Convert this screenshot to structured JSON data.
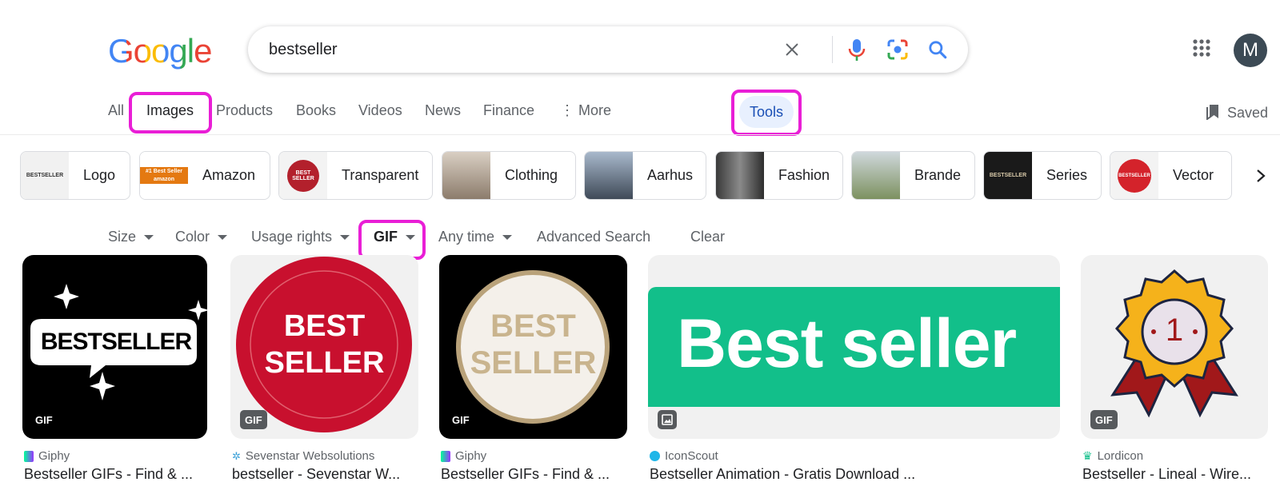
{
  "logo": {
    "text": "Google"
  },
  "search": {
    "value": "bestseller"
  },
  "icons": {
    "clear": "close-icon",
    "voice": "microphone-icon",
    "lens": "camera-lens-icon",
    "search": "search-icon",
    "apps": "apps-grid-icon",
    "saved": "bookmark-icon",
    "next": "chevron-right-icon"
  },
  "account": {
    "avatar_letter": "M",
    "color": "#3c4a55"
  },
  "tabs": [
    {
      "label": "All"
    },
    {
      "label": "Images"
    },
    {
      "label": "Products"
    },
    {
      "label": "Books"
    },
    {
      "label": "Videos"
    },
    {
      "label": "News"
    },
    {
      "label": "Finance"
    },
    {
      "label": "⋮ More"
    }
  ],
  "tools": {
    "label": "Tools"
  },
  "saved": {
    "label": "Saved"
  },
  "chips": [
    {
      "label": "Logo",
      "thumb_text": "BESTSELLER"
    },
    {
      "label": "Amazon",
      "thumb_text": "#1 Best Seller amazon"
    },
    {
      "label": "Transparent",
      "thumb_text": "BEST SELLER"
    },
    {
      "label": "Clothing"
    },
    {
      "label": "Aarhus"
    },
    {
      "label": "Fashion"
    },
    {
      "label": "Brande"
    },
    {
      "label": "Series",
      "thumb_text": "BESTSELLER"
    },
    {
      "label": "Vector",
      "thumb_text": "BESTSELLER"
    }
  ],
  "filters": [
    {
      "label": "Size",
      "dropdown": true
    },
    {
      "label": "Color",
      "dropdown": true
    },
    {
      "label": "Usage rights",
      "dropdown": true
    },
    {
      "label": "GIF",
      "dropdown": true,
      "active": true
    },
    {
      "label": "Any time",
      "dropdown": true
    },
    {
      "label": "Advanced Search",
      "dropdown": false
    },
    {
      "label": "Clear",
      "dropdown": false
    }
  ],
  "results": [
    {
      "image_text": "BESTSELLER",
      "badge": "GIF",
      "source": "Giphy",
      "title": "Bestseller GIFs - Find & ..."
    },
    {
      "image_text_1": "BEST",
      "image_text_2": "SELLER",
      "badge": "GIF",
      "source": "Sevenstar Websolutions",
      "title": "bestseller - Sevenstar W..."
    },
    {
      "image_text_1": "BEST",
      "image_text_2": "SELLER",
      "badge": "GIF",
      "source": "Giphy",
      "title": "Bestseller GIFs - Find & ..."
    },
    {
      "image_text": "Best seller",
      "badge": "image-icon",
      "source": "IconScout",
      "title": "Bestseller Animation - Gratis Download ..."
    },
    {
      "image_text": "1",
      "badge": "GIF",
      "source": "Lordicon",
      "title": "Bestseller - Lineal - Wire..."
    }
  ],
  "colors": {
    "highlight": "#e91ed6",
    "tools_bg": "#e8f0fe",
    "green": "#12bf8a",
    "red": "#c8102e"
  }
}
